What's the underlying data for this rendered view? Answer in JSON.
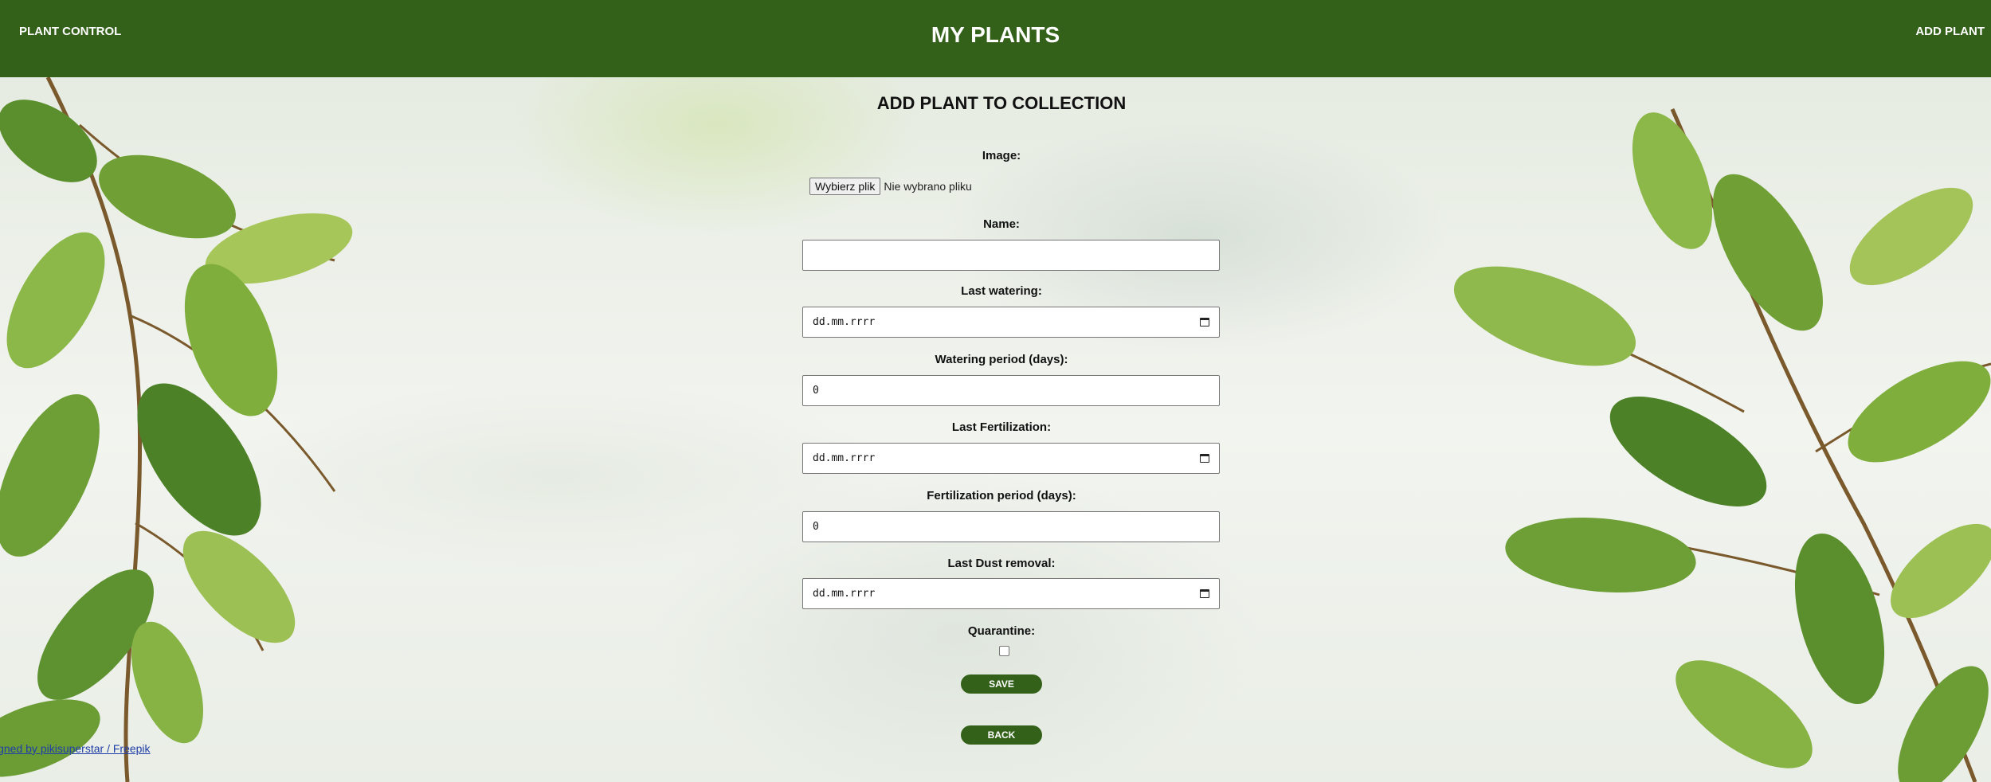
{
  "header": {
    "brand": "PLANT CONTROL",
    "title": "MY PLANTS",
    "add_link": "ADD PLANT",
    "background_color": "#33611a"
  },
  "form": {
    "title": "ADD PLANT TO COLLECTION",
    "image": {
      "label": "Image:",
      "button_label": "Wybierz plik",
      "status": "Nie wybrano pliku"
    },
    "name": {
      "label": "Name:",
      "value": ""
    },
    "last_watering": {
      "label": "Last watering:",
      "value": "dd.mm.rrrr"
    },
    "watering_period": {
      "label": "Watering period (days):",
      "value": "0"
    },
    "last_fertilization": {
      "label": "Last Fertilization:",
      "value": "dd.mm.rrrr"
    },
    "fertilization_period": {
      "label": "Fertilization period (days):",
      "value": "0"
    },
    "last_dust_removal": {
      "label": "Last Dust removal:",
      "value": "dd.mm.rrrr"
    },
    "quarantine": {
      "label": "Quarantine:",
      "checked": false
    },
    "save_label": "SAVE",
    "back_label": "BACK"
  },
  "footer": {
    "credit": "igned by pikisuperstar / Freepik"
  }
}
